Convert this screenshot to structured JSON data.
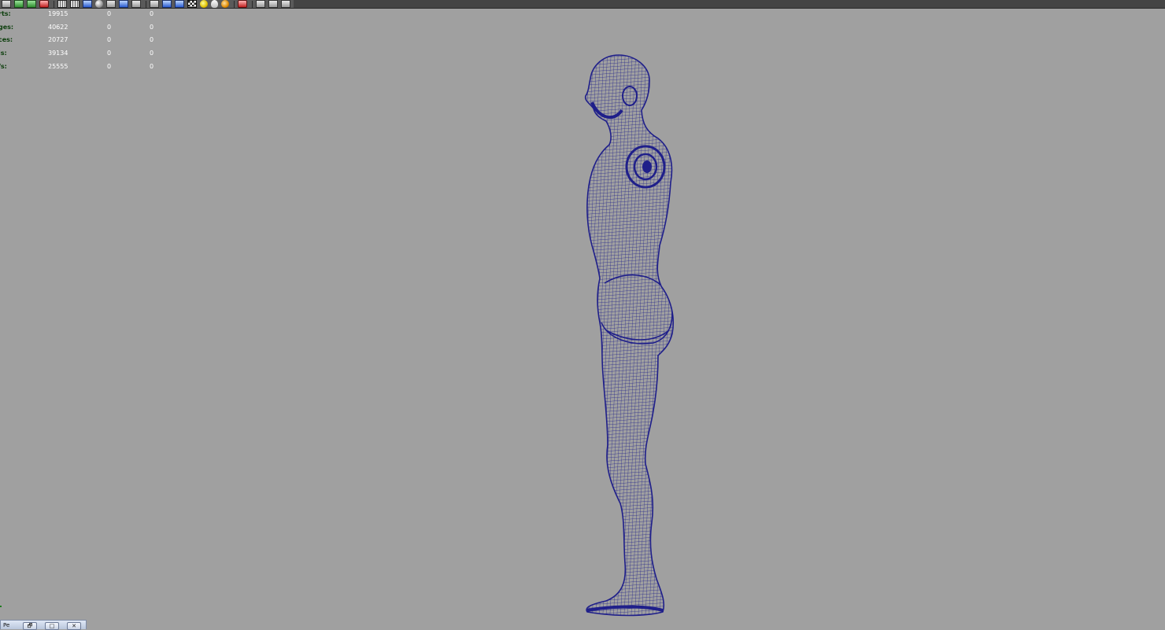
{
  "toolbar": {
    "icons": [
      "panel-icon",
      "shelf-icon",
      "snap-icon",
      "select-icon",
      "grid-icon",
      "wireframe-icon",
      "smooth-shade-icon",
      "bounding-box-icon",
      "textured-icon",
      "xray-icon",
      "isolate-icon",
      "default-light-icon",
      "all-lights-icon",
      "shadow-icon",
      "camera-icon",
      "display-icon",
      "pick-icon",
      "cube-icon",
      "frame-icon"
    ]
  },
  "hud": {
    "rows": [
      {
        "label": "rts:",
        "values": [
          "19915",
          "0",
          "0"
        ]
      },
      {
        "label": "ges:",
        "values": [
          "40622",
          "0",
          "0"
        ]
      },
      {
        "label": "ces:",
        "values": [
          "20727",
          "0",
          "0"
        ]
      },
      {
        "label": "is:",
        "values": [
          "39134",
          "0",
          "0"
        ]
      },
      {
        "label": "/s:",
        "values": [
          "25555",
          "0",
          "0"
        ]
      }
    ]
  },
  "viewport": {
    "background": "#a0a0a0",
    "wire_color": "#1f1f8a"
  },
  "mini_window": {
    "title": "Pe",
    "restore_glyph": "🗗",
    "maximize_glyph": "□",
    "close_glyph": "✕"
  }
}
